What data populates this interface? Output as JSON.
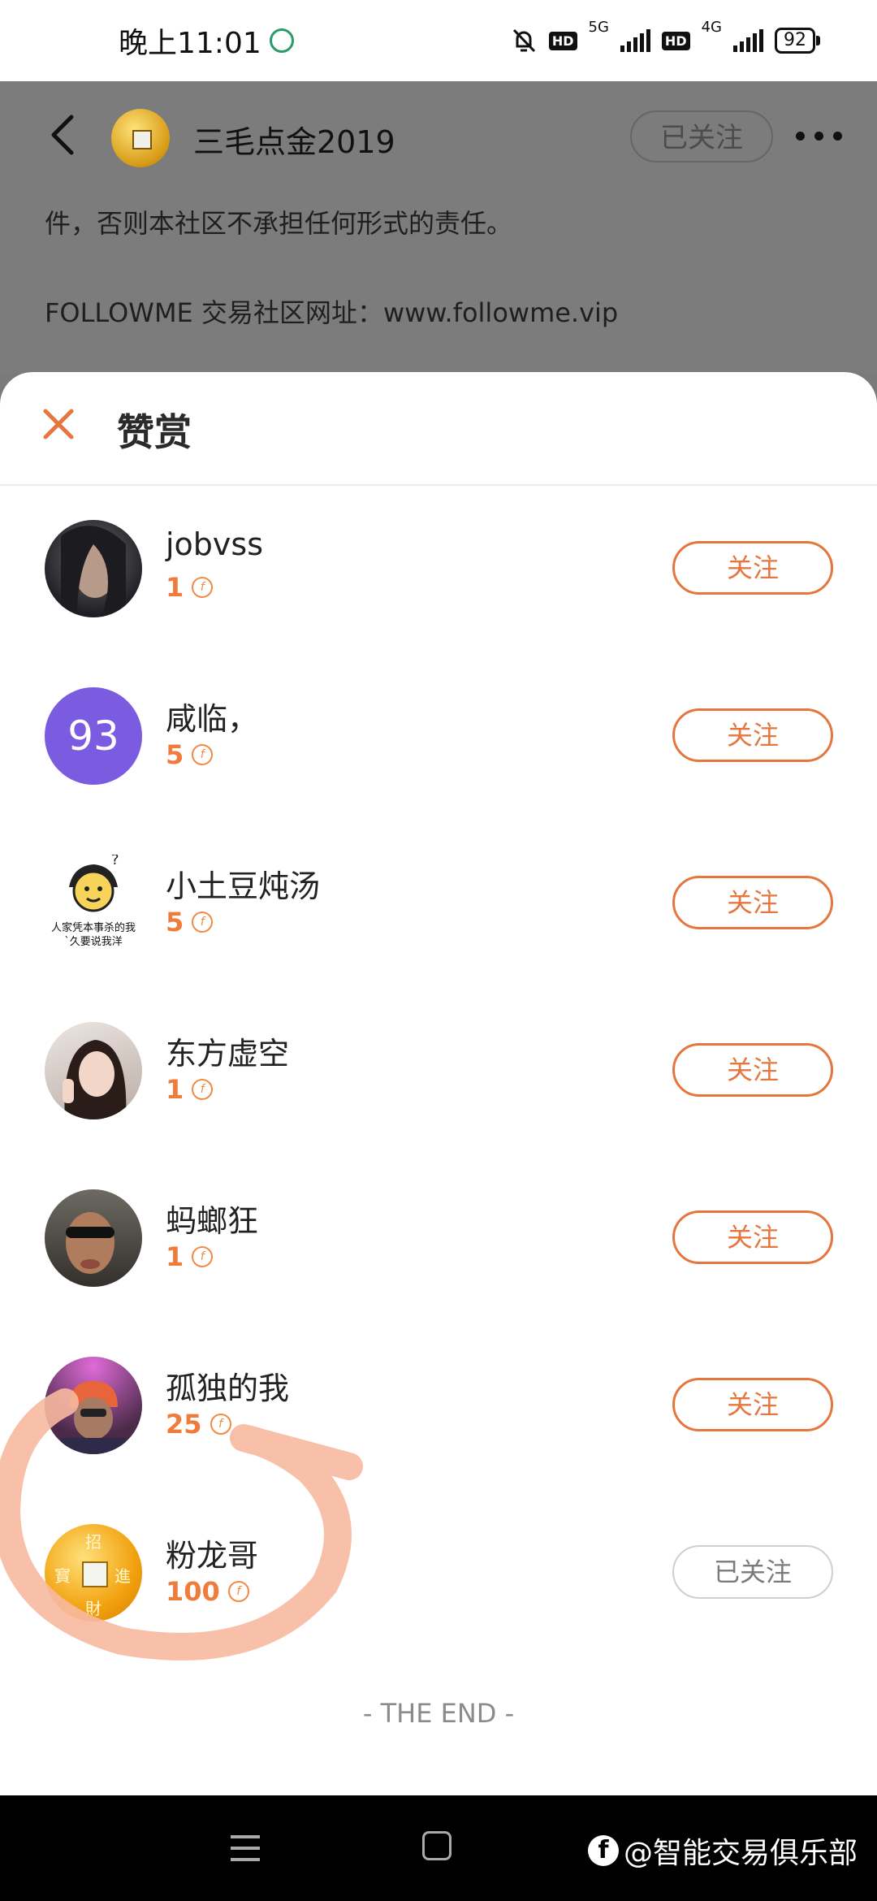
{
  "status_bar": {
    "time": "晚上11:01",
    "net1": "5G",
    "net2": "4G",
    "hd": "HD",
    "battery": "92"
  },
  "background_page": {
    "author_name": "三毛点金2019",
    "follow_state": "已关注",
    "line1": "件，否则本社区不承担任何形式的责任。",
    "line2": "FOLLOWME 交易社区网址：www.followme.vip"
  },
  "sheet": {
    "title": "赞赏",
    "follow_label": "关注",
    "followed_label": "已关注",
    "end_text": "- THE END -",
    "coin_symbol": "f",
    "rows": [
      {
        "name": "jobvss",
        "amount": "1",
        "followed": false
      },
      {
        "name": "咸临，",
        "amount": "5",
        "followed": false,
        "avatar_text": "93"
      },
      {
        "name": "小土豆炖汤",
        "amount": "5",
        "followed": false
      },
      {
        "name": "东方虚空",
        "amount": "1",
        "followed": false
      },
      {
        "name": "蚂螂狂",
        "amount": "1",
        "followed": false
      },
      {
        "name": "孤独的我",
        "amount": "25",
        "followed": false
      },
      {
        "name": "粉龙哥",
        "amount": "100",
        "followed": true
      }
    ]
  },
  "avatar3_caption1": "人家凭本事杀的我",
  "avatar3_caption2": "`久要说我洋",
  "coin_chars": {
    "top": "招",
    "left": "寳",
    "right": "進",
    "bottom": "財"
  },
  "watermark": "@智能交易俱乐部",
  "colors": {
    "accent": "#e4763e",
    "scribble": "#f7b9a0",
    "avatar_purple": "#7b5ce0"
  }
}
